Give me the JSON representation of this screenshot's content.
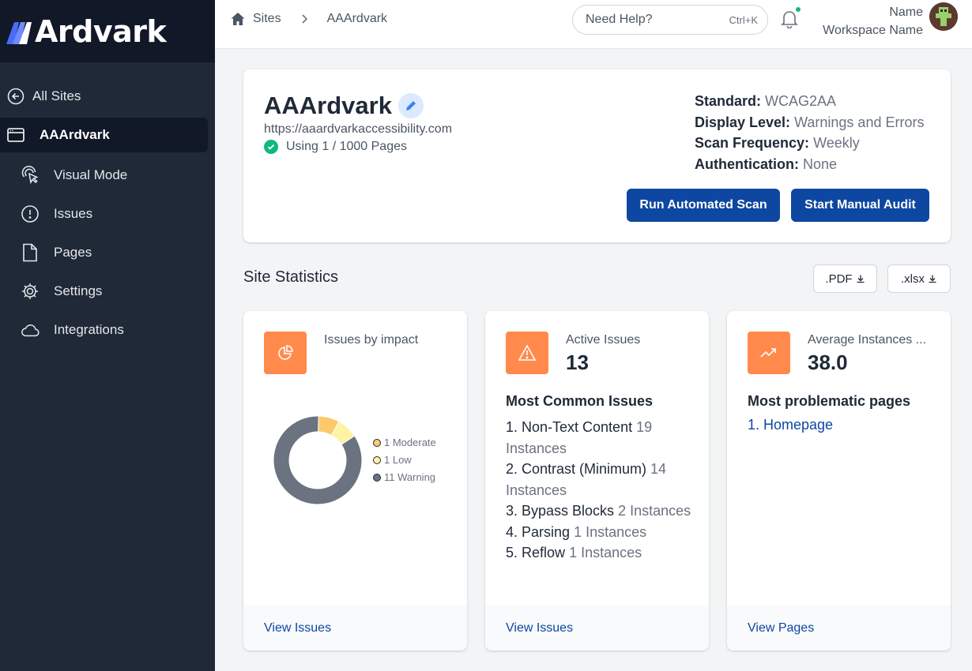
{
  "brand": {
    "logo_text": "Ardvark"
  },
  "sidebar": {
    "all_sites": "All Sites",
    "site": "AAArdvark",
    "items": [
      "Visual Mode",
      "Issues",
      "Pages",
      "Settings",
      "Integrations"
    ]
  },
  "topbar": {
    "breadcrumbs": [
      "Sites",
      "AAArdvark"
    ],
    "help_placeholder": "Need Help?",
    "help_shortcut": "Ctrl+K",
    "user_name": "Name",
    "workspace_name": "Workspace Name"
  },
  "site": {
    "name": "AAArdvark",
    "url": "https://aaardvarkaccessibility.com",
    "usage": "Using 1 / 1000 Pages",
    "standard_label": "Standard:",
    "standard": "WCAG2AA",
    "display_level_label": "Display Level:",
    "display_level": "Warnings and Errors",
    "scan_frequency_label": "Scan Frequency:",
    "scan_frequency": "Weekly",
    "authentication_label": "Authentication:",
    "authentication": "None",
    "run_scan": "Run Automated Scan",
    "start_audit": "Start Manual Audit"
  },
  "statistics": {
    "title": "Site Statistics",
    "export_pdf": ".PDF",
    "export_xlsx": ".xlsx",
    "impact": {
      "label": "Issues by impact",
      "legend": [
        "1 Moderate",
        "1 Low",
        "11 Warning"
      ],
      "footer": "View Issues"
    },
    "active": {
      "label": "Active Issues",
      "value": "13",
      "subtitle": "Most Common Issues",
      "issues": [
        {
          "name": "1. Non-Text Content",
          "count": "19 Instances"
        },
        {
          "name": "2. Contrast (Minimum)",
          "count": "14 Instances"
        },
        {
          "name": "3. Bypass Blocks",
          "count": "2 Instances"
        },
        {
          "name": "4. Parsing",
          "count": "1 Instances"
        },
        {
          "name": "5. Reflow",
          "count": "1 Instances"
        }
      ],
      "footer": "View Issues"
    },
    "average": {
      "label": "Average Instances ...",
      "value": "38.0",
      "subtitle": "Most problematic pages",
      "pages": [
        "1. Homepage"
      ],
      "footer": "View Pages"
    }
  },
  "chart_data": {
    "type": "pie",
    "categories": [
      "Moderate",
      "Low",
      "Warning"
    ],
    "values": [
      1,
      1,
      11
    ],
    "colors": [
      "#fcc96b",
      "#fdf3a4",
      "#6b7280"
    ],
    "legend_position": "right"
  }
}
